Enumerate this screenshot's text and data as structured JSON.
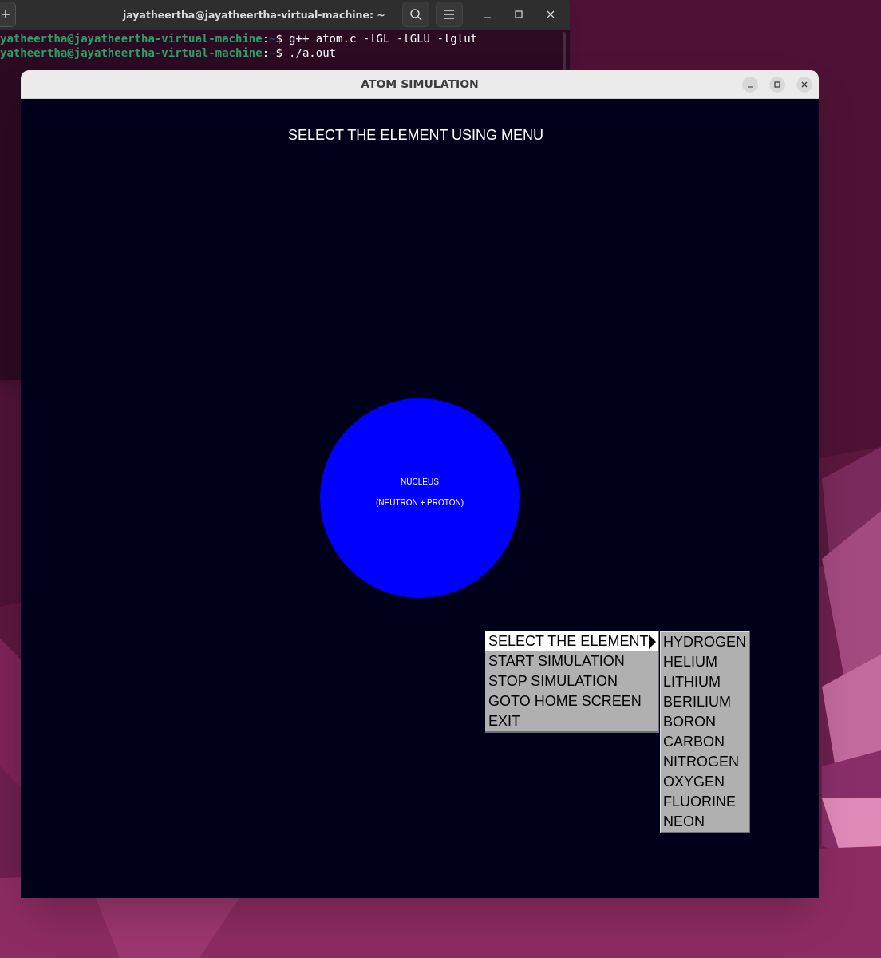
{
  "terminal": {
    "title": "jayatheertha@jayatheertha-virtual-machine: ~",
    "lines": [
      {
        "prompt": "yatheertha@jayatheertha-virtual-machine",
        "separator": ":",
        "path": "~",
        "symbol": "$",
        "command": "g++ atom.c -lGL -lGLU -lglut"
      },
      {
        "prompt": "yatheertha@jayatheertha-virtual-machine",
        "separator": ":",
        "path": "~",
        "symbol": "$",
        "command": "./a.out"
      }
    ]
  },
  "app_window": {
    "title": "ATOM SIMULATION",
    "heading": "SELECT THE ELEMENT USING MENU",
    "nucleus": {
      "label": "NUCLEUS",
      "sublabel": "(NEUTRON + PROTON)"
    },
    "menu": {
      "items": [
        {
          "label": "SELECT THE ELEMENT",
          "selected": true,
          "has_submenu": true
        },
        {
          "label": "START SIMULATION",
          "selected": false,
          "has_submenu": false
        },
        {
          "label": "STOP SIMULATION",
          "selected": false,
          "has_submenu": false
        },
        {
          "label": "GOTO HOME SCREEN",
          "selected": false,
          "has_submenu": false
        },
        {
          "label": "EXIT",
          "selected": false,
          "has_submenu": false
        }
      ]
    },
    "submenu": {
      "items": [
        {
          "label": "HYDROGEN"
        },
        {
          "label": "HELIUM"
        },
        {
          "label": "LITHIUM"
        },
        {
          "label": "BERILIUM"
        },
        {
          "label": "BORON"
        },
        {
          "label": "CARBON"
        },
        {
          "label": "NITROGEN"
        },
        {
          "label": "OXYGEN"
        },
        {
          "label": "FLUORINE"
        },
        {
          "label": "NEON"
        }
      ]
    }
  }
}
